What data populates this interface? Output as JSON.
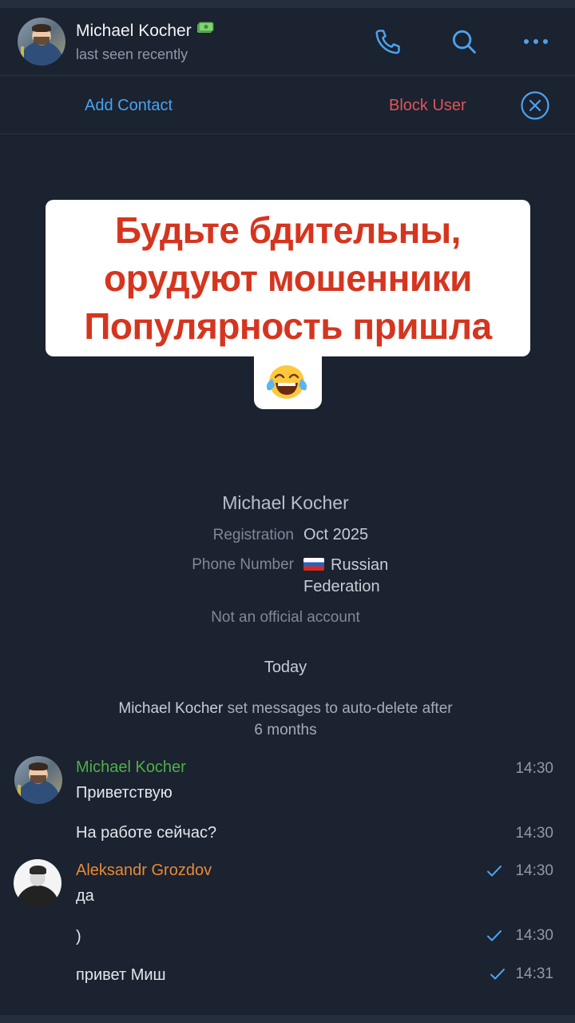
{
  "header": {
    "name": "Michael Kocher",
    "status": "last seen recently",
    "badge_icon": "money-icon"
  },
  "actions": {
    "add_contact": "Add Contact",
    "block_user": "Block User"
  },
  "banner": {
    "lines": [
      "Будьте бдительны,",
      "орудуют мошенники",
      "Популярность пришла"
    ],
    "emoji_icon": "face-with-tears-of-joy-icon",
    "text_color": "#d5351f"
  },
  "info": {
    "name": "Michael Kocher",
    "registration_label": "Registration",
    "registration_value": "Oct 2025",
    "phone_label": "Phone Number",
    "phone_value_line1": "Russian",
    "phone_value_line2": "Federation",
    "phone_flag_icon": "russia-flag-icon",
    "note": "Not an official account"
  },
  "chat": {
    "date": "Today",
    "service_name": "Michael Kocher",
    "service_line1_rest": " set messages to auto-delete after",
    "service_line2": "6 months",
    "groups": [
      {
        "author": "Michael Kocher",
        "author_color": "#4eb046",
        "messages": [
          {
            "text": "Приветствую",
            "time": "14:30",
            "read": false
          },
          {
            "text": "На работе сейчас?",
            "time": "14:30",
            "read": false
          }
        ]
      },
      {
        "author": "Aleksandr Grozdov",
        "author_color": "#e88a33",
        "messages": [
          {
            "text": "да",
            "time": "14:30",
            "read": true
          },
          {
            "text": ")",
            "time": "14:30",
            "read": true
          },
          {
            "text": "привет Миш",
            "time": "14:31",
            "read": true
          }
        ]
      }
    ]
  },
  "colors": {
    "background": "#1b2230",
    "link": "#4ba3ef",
    "danger": "#e05557"
  }
}
